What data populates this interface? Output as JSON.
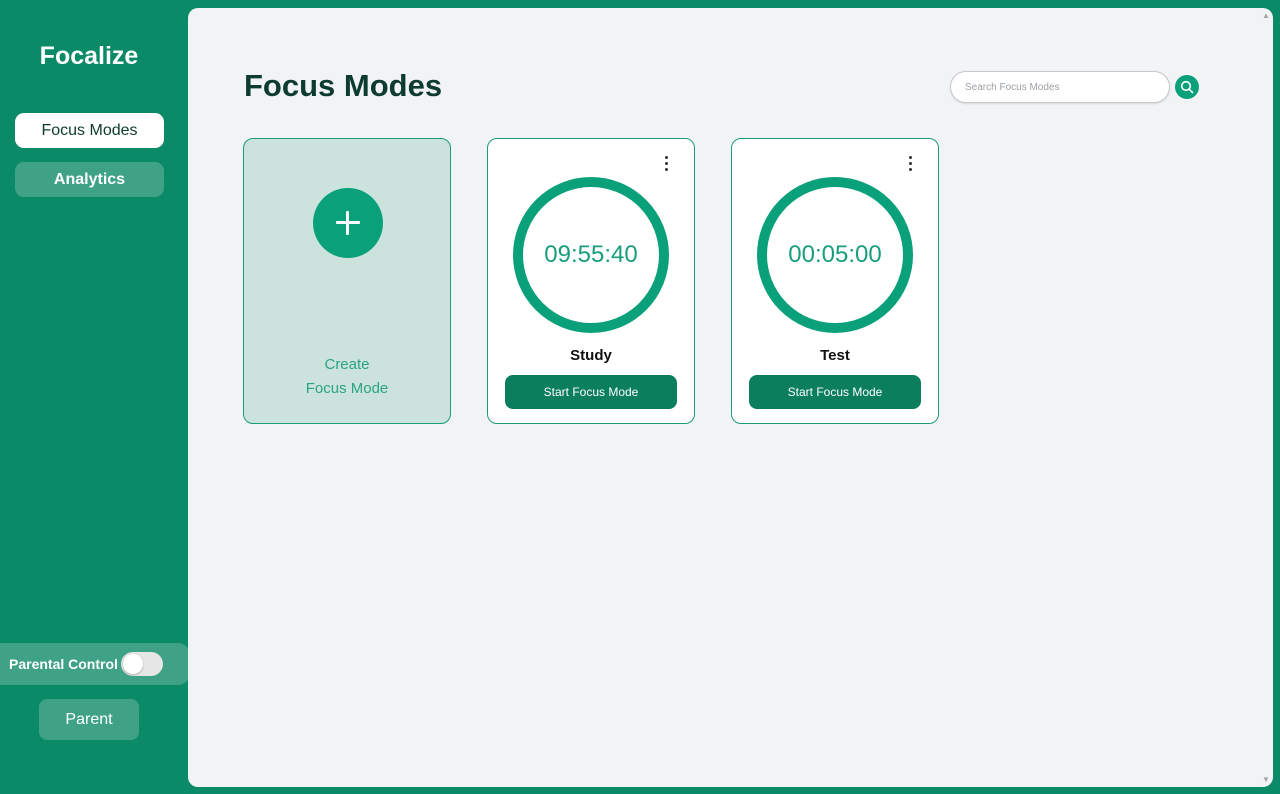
{
  "app": {
    "title": "Focalize"
  },
  "sidebar": {
    "items": [
      {
        "label": "Focus Modes",
        "active": true
      },
      {
        "label": "Analytics",
        "active": false
      }
    ],
    "parental_control": {
      "label": "Parental Control",
      "enabled": false
    },
    "parent_button": "Parent"
  },
  "main": {
    "title": "Focus Modes",
    "search": {
      "placeholder": "Search Focus Modes",
      "value": "",
      "icon": "search-icon"
    },
    "create_card": {
      "line1": "Create",
      "line2": "Focus Mode",
      "icon": "plus-icon"
    },
    "modes": [
      {
        "name": "Study",
        "time": "09:55:40",
        "button": "Start Focus Mode",
        "menu_icon": "more-vertical-icon"
      },
      {
        "name": "Test",
        "time": "00:05:00",
        "button": "Start Focus Mode",
        "menu_icon": "more-vertical-icon"
      }
    ]
  },
  "colors": {
    "brand_green": "#0a8a66",
    "accent_green": "#0aa07a",
    "button_green": "#0b7e5e",
    "background": "#f2f3f5"
  }
}
